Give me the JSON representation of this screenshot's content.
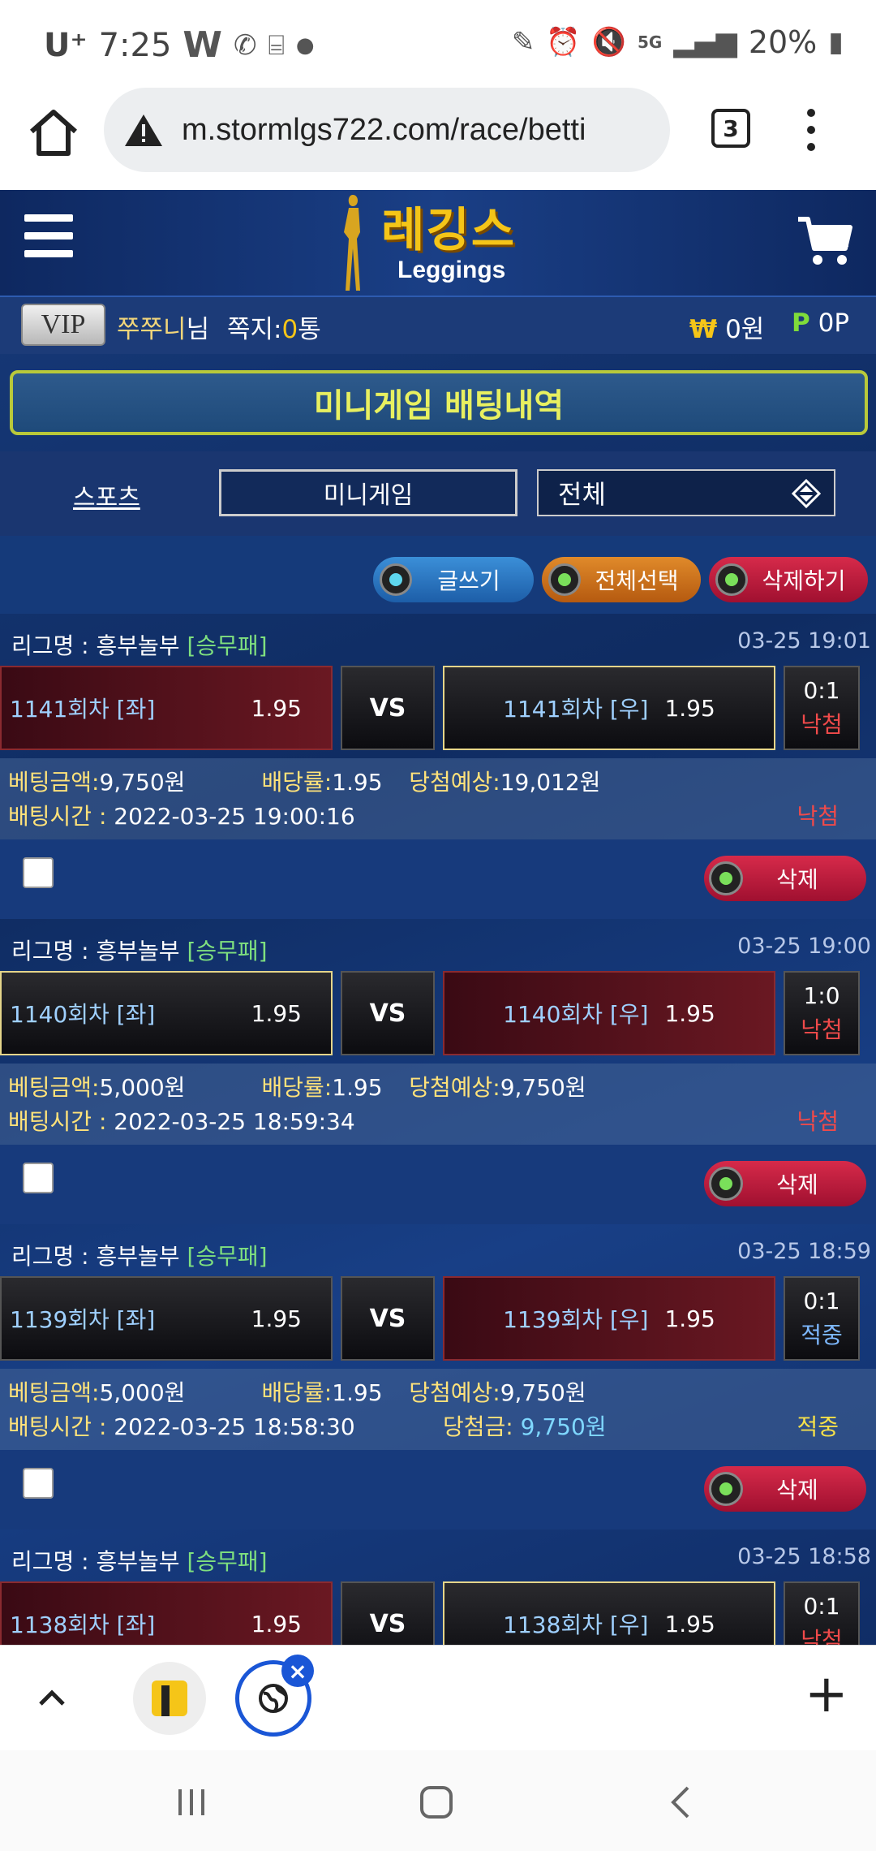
{
  "status_bar": {
    "carrier": "U⁺",
    "time": "7:25",
    "battery": "20%",
    "net": "5G"
  },
  "browser": {
    "url": "m.stormlgs722.com/race/betti",
    "tab_count": "3"
  },
  "site": {
    "logo_ko": "레깅스",
    "logo_en": "Leggings",
    "vip_badge": "VIP",
    "user_name": "쭈쭈니",
    "user_suffix": "님",
    "note_label": "쪽지:",
    "note_count": "0",
    "note_unit": "통",
    "won_symbol": "₩",
    "won_value": "0원",
    "point_symbol": "P",
    "point_value": "0P",
    "page_title": "미니게임 배팅내역"
  },
  "filters": {
    "sports": "스포츠",
    "minigame": "미니게임",
    "select_value": "전체"
  },
  "actions": {
    "write": "글쓰기",
    "select_all": "전체선택",
    "delete": "삭제하기"
  },
  "labels": {
    "league": "리그명 : ",
    "vs": "VS",
    "bet_amount": "베팅금액:",
    "odds": "배당률:",
    "expected": "당첨예상:",
    "bet_time": "배팅시간 : ",
    "prize": "당첨금:",
    "delete": "삭제"
  },
  "bets": [
    {
      "league": "흥부놀부",
      "type": "[승무패]",
      "datetime": "03-25 19:01",
      "left_label": "1141회차 [좌]",
      "left_odds": "1.95",
      "right_label": "1141회차 [우]",
      "right_odds": "1.95",
      "score": "0:1",
      "result": "낙첨",
      "amount": " 9,750원",
      "odds": " 1.95",
      "expected": " 19,012원",
      "time": "2022-03-25 19:00:16",
      "status": "낙첨",
      "prize": ""
    },
    {
      "league": "흥부놀부",
      "type": "[승무패]",
      "datetime": "03-25 19:00",
      "left_label": "1140회차 [좌]",
      "left_odds": "1.95",
      "right_label": "1140회차 [우]",
      "right_odds": "1.95",
      "score": "1:0",
      "result": "낙첨",
      "amount": " 5,000원",
      "odds": " 1.95",
      "expected": " 9,750원",
      "time": "2022-03-25 18:59:34",
      "status": "낙첨",
      "prize": ""
    },
    {
      "league": "흥부놀부",
      "type": "[승무패]",
      "datetime": "03-25 18:59",
      "left_label": "1139회차 [좌]",
      "left_odds": "1.95",
      "right_label": "1139회차 [우]",
      "right_odds": "1.95",
      "score": "0:1",
      "result": "적중",
      "amount": " 5,000원",
      "odds": " 1.95",
      "expected": " 9,750원",
      "time": "2022-03-25 18:58:30",
      "status": "적중",
      "prize": " 9,750원"
    },
    {
      "league": "흥부놀부",
      "type": "[승무패]",
      "datetime": "03-25 18:58",
      "left_label": "1138회차 [좌]",
      "left_odds": "1.95",
      "right_label": "1138회차 [우]",
      "right_odds": "1.95",
      "score": "0:1",
      "result": "낙첨"
    }
  ],
  "colors": {
    "accent_gold": "#f5c518",
    "loss_red": "#f04a4a",
    "win_yellow": "#f5e04a",
    "page_bg": "#0f2c62"
  },
  "icons": [
    "home-icon",
    "warning-icon",
    "menu-dots-icon",
    "hamburger-icon",
    "cart-icon",
    "dropdown-icon",
    "chevron-up-icon",
    "plus-icon",
    "recents-icon",
    "home-nav-icon",
    "back-icon"
  ]
}
